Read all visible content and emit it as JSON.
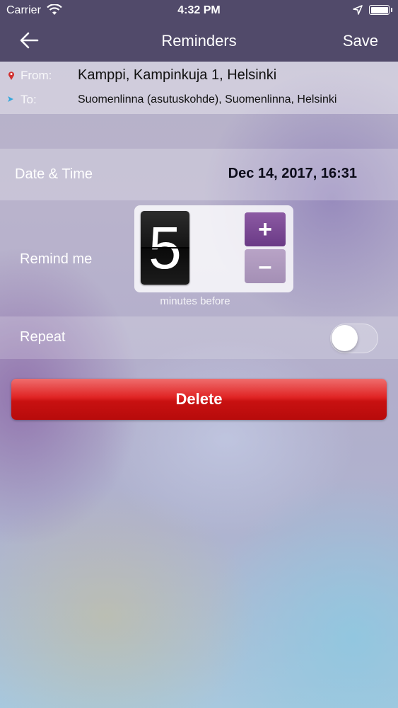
{
  "status_bar": {
    "carrier": "Carrier",
    "time": "4:32 PM"
  },
  "nav": {
    "title": "Reminders",
    "save_label": "Save"
  },
  "route": {
    "from_label": "From:",
    "from_value": "Kamppi, Kampinkuja 1, Helsinki",
    "to_label": "To:",
    "to_value": "Suomenlinna (asutuskohde), Suomenlinna, Helsinki"
  },
  "datetime": {
    "label": "Date & Time",
    "value": "Dec 14, 2017, 16:31"
  },
  "remind": {
    "label": "Remind me",
    "minutes": "5",
    "plus": "+",
    "minus": "–",
    "caption": "minutes before"
  },
  "repeat": {
    "label": "Repeat",
    "enabled": false
  },
  "delete_label": "Delete",
  "colors": {
    "nav_bar": "#514a6a",
    "plus_button": "#6a3a86",
    "minus_button": "#a48fb5",
    "delete_button": "#d01818",
    "from_pin": "#d03030",
    "to_arrow": "#35a7dc"
  }
}
